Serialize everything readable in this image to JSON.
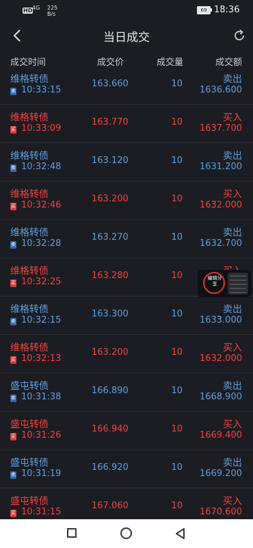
{
  "status_bar": {
    "hd": "HD",
    "signal": "4G",
    "speed_value": "225",
    "speed_unit": "B/s",
    "battery": "69",
    "time": "18:36"
  },
  "header": {
    "title": "当日成交"
  },
  "columns": {
    "time": "成交时间",
    "price": "成交价",
    "volume": "成交量",
    "amount": "成交额"
  },
  "trades": [
    {
      "name": "维格转债",
      "flag": "卖",
      "time": "10:33:15",
      "price": "163.660",
      "volume": "10",
      "side": "卖出",
      "amount": "1636.600",
      "type": "sell"
    },
    {
      "name": "维格转债",
      "flag": "买",
      "time": "10:33:09",
      "price": "163.770",
      "volume": "10",
      "side": "买入",
      "amount": "1637.700",
      "type": "buy"
    },
    {
      "name": "维格转债",
      "flag": "卖",
      "time": "10:32:48",
      "price": "163.120",
      "volume": "10",
      "side": "卖出",
      "amount": "1631.200",
      "type": "sell"
    },
    {
      "name": "维格转债",
      "flag": "买",
      "time": "10:32:46",
      "price": "163.200",
      "volume": "10",
      "side": "买入",
      "amount": "1632.000",
      "type": "buy"
    },
    {
      "name": "维格转债",
      "flag": "卖",
      "time": "10:32:28",
      "price": "163.270",
      "volume": "10",
      "side": "卖出",
      "amount": "1632.700",
      "type": "sell"
    },
    {
      "name": "维格转债",
      "flag": "买",
      "time": "10:32:25",
      "price": "163.280",
      "volume": "10",
      "side": "买入",
      "amount": "",
      "type": "buy"
    },
    {
      "name": "维格转债",
      "flag": "卖",
      "time": "10:32:15",
      "price": "163.300",
      "volume": "10",
      "side": "卖出",
      "amount": "1633.000",
      "type": "sell"
    },
    {
      "name": "维格转债",
      "flag": "买",
      "time": "10:32:13",
      "price": "163.200",
      "volume": "10",
      "side": "买入",
      "amount": "1632.000",
      "type": "buy"
    },
    {
      "name": "盛屯转债",
      "flag": "卖",
      "time": "10:31:38",
      "price": "166.890",
      "volume": "10",
      "side": "卖出",
      "amount": "1668.900",
      "type": "sell"
    },
    {
      "name": "盛屯转债",
      "flag": "买",
      "time": "10:31:26",
      "price": "166.940",
      "volume": "10",
      "side": "买入",
      "amount": "1669.400",
      "type": "buy"
    },
    {
      "name": "盛屯转债",
      "flag": "卖",
      "time": "10:31:19",
      "price": "166.920",
      "volume": "10",
      "side": "卖出",
      "amount": "1669.200",
      "type": "sell"
    },
    {
      "name": "盛屯转债",
      "flag": "买",
      "time": "10:31:15",
      "price": "167.060",
      "volume": "10",
      "side": "买入",
      "amount": "1670.600",
      "type": "buy"
    }
  ],
  "floating_widget": {
    "label": "编辑分享"
  },
  "colors": {
    "buy": "#f2403c",
    "sell": "#5b9fe0",
    "background": "#1c1d22"
  },
  "icons": {
    "back": "chevron-left-icon",
    "refresh": "refresh-icon",
    "nav_recent": "square-icon",
    "nav_home": "circle-icon",
    "nav_back": "triangle-back-icon"
  }
}
